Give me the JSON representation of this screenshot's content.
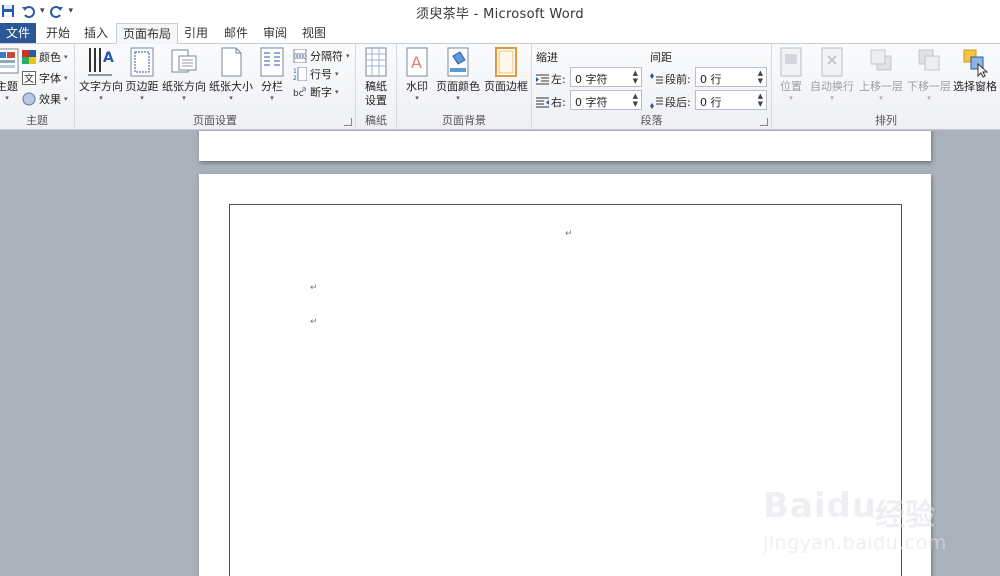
{
  "window": {
    "title": "须臾茶毕 - Microsoft Word"
  },
  "quick_access": [
    {
      "name": "save-icon",
      "glyph": "💾"
    },
    {
      "name": "undo-icon",
      "glyph": "↶"
    },
    {
      "name": "redo-icon",
      "glyph": "↻"
    },
    {
      "name": "customize-icon",
      "glyph": "▾"
    }
  ],
  "tabs": {
    "file": "文件",
    "items": [
      "开始",
      "插入",
      "页面布局",
      "引用",
      "邮件",
      "审阅",
      "视图"
    ],
    "active": "页面布局"
  },
  "ribbon": {
    "theme": {
      "label": "主题",
      "button": "主题",
      "colors": "颜色",
      "fonts": "字体",
      "effects": "效果"
    },
    "page_setup": {
      "label": "页面设置",
      "text_direction": "文字方向",
      "margins": "页边距",
      "orientation": "纸张方向",
      "size": "纸张大小",
      "columns": "分栏",
      "breaks": "分隔符",
      "line_numbers": "行号",
      "hyphenation": "断字"
    },
    "manuscript": {
      "label": "稿纸",
      "button": "稿纸\n设置"
    },
    "page_background": {
      "label": "页面背景",
      "watermark": "水印",
      "page_color": "页面颜色",
      "page_borders": "页面边框"
    },
    "paragraph": {
      "label": "段落",
      "indent_title": "缩进",
      "spacing_title": "间距",
      "left_label": "左:",
      "left_value": "0 字符",
      "right_label": "右:",
      "right_value": "0 字符",
      "before_label": "段前:",
      "before_value": "0 行",
      "after_label": "段后:",
      "after_value": "0 行"
    },
    "arrange": {
      "label": "排列",
      "position": "位置",
      "wrap_text": "自动换行",
      "bring_forward": "上移一层",
      "send_backward": "下移一层",
      "selection_pane": "选择窗格"
    }
  },
  "document": {
    "paragraph_mark": "↵"
  },
  "watermark": {
    "brand": "Baidu",
    "cn": "经验",
    "url": "jingyan.baidu.com"
  },
  "colors": {
    "file_tab": "#2b5797",
    "ribbon_bg": "#eef0f3",
    "doc_bg": "#abb1ba"
  }
}
